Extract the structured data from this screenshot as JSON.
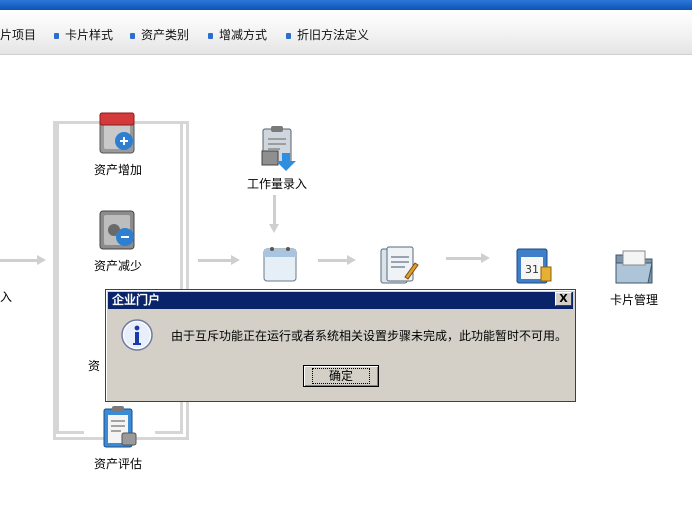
{
  "toolbar": {
    "items": [
      "片项目",
      "卡片样式",
      "资产类别",
      "增减方式",
      "折旧方法定义"
    ]
  },
  "flow": {
    "left_partial_label": "入",
    "nodes": {
      "asset_add": "资产增加",
      "asset_reduce": "资产减少",
      "asset_partial": "资",
      "asset_eval": "资产评估",
      "workload_entry": "工作量录入",
      "card_manage": "卡片管理"
    }
  },
  "dialog": {
    "title": "企业门户",
    "close": "X",
    "message": "由于互斥功能正在运行或者系统相关设置步骤未完成，此功能暂时不可用。",
    "ok_label": "确定"
  },
  "colors": {
    "titlebar": "#0a246a",
    "topbar": "#1e63c8",
    "dialog_bg": "#d4d0c8"
  }
}
